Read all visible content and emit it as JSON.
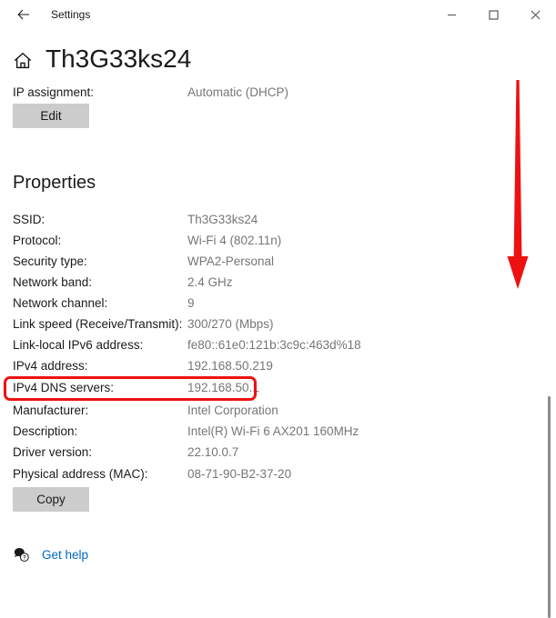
{
  "window": {
    "title": "Settings",
    "back_icon": "back-arrow-icon",
    "minimize_glyph": "—",
    "maximize_glyph": "□",
    "close_glyph": "✕"
  },
  "header": {
    "home_icon": "home-icon",
    "network_name": "Th3G33ks24"
  },
  "ip_assignment": {
    "label": "IP assignment:",
    "value": "Automatic (DHCP)",
    "edit_button": "Edit"
  },
  "properties": {
    "heading": "Properties",
    "rows": [
      {
        "label": "SSID:",
        "value": "Th3G33ks24"
      },
      {
        "label": "Protocol:",
        "value": "Wi-Fi 4 (802.11n)"
      },
      {
        "label": "Security type:",
        "value": "WPA2-Personal"
      },
      {
        "label": "Network band:",
        "value": "2.4 GHz"
      },
      {
        "label": "Network channel:",
        "value": "9"
      },
      {
        "label": "Link speed (Receive/Transmit):",
        "value": "300/270 (Mbps)"
      },
      {
        "label": "Link-local IPv6 address:",
        "value": "fe80::61e0:121b:3c9c:463d%18"
      },
      {
        "label": "IPv4 address:",
        "value": "192.168.50.219"
      },
      {
        "label": "IPv4 DNS servers:",
        "value": "192.168.50.1"
      },
      {
        "label": "Manufacturer:",
        "value": "Intel Corporation"
      },
      {
        "label": "Description:",
        "value": "Intel(R) Wi-Fi 6 AX201 160MHz"
      },
      {
        "label": "Driver version:",
        "value": "22.10.0.7"
      },
      {
        "label": "Physical address (MAC):",
        "value": "08-71-90-B2-37-20"
      }
    ],
    "copy_button": "Copy"
  },
  "footer": {
    "help_icon": "help-question-bubble-icon",
    "help_link": "Get help"
  },
  "annotations": {
    "highlight_color": "#ee1111",
    "arrow_color": "#ee1111",
    "highlighted_row": "IPv4 DNS servers:",
    "arrow_direction": "down"
  }
}
